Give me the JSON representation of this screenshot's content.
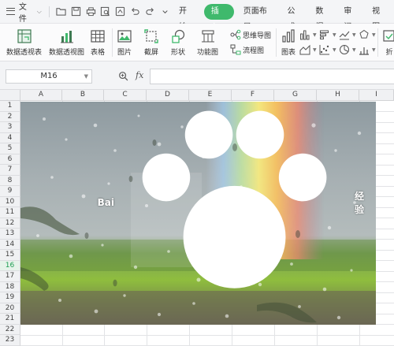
{
  "menubar": {
    "file_label": "文件",
    "tabs": [
      {
        "label": "开始"
      },
      {
        "label": "插入"
      },
      {
        "label": "页面布局"
      },
      {
        "label": "公式"
      },
      {
        "label": "数据"
      },
      {
        "label": "审阅"
      },
      {
        "label": "视图"
      }
    ],
    "active_tab": "插入",
    "accent": "#3fb96c"
  },
  "ribbon": {
    "pivot_table": "数据透视表",
    "pivot_chart": "数据透视图",
    "table": "表格",
    "picture": "图片",
    "screenshot": "截屏",
    "shapes": "形状",
    "function_chart": "功能图",
    "mind_map": "思维导图",
    "flowchart": "流程图",
    "chart": "图表",
    "fold": "折"
  },
  "formula_bar": {
    "name_box": "M16",
    "fx": "fx",
    "formula": ""
  },
  "grid": {
    "columns": [
      "A",
      "B",
      "C",
      "D",
      "E",
      "F",
      "G",
      "H",
      "I"
    ],
    "rows": [
      "1",
      "2",
      "3",
      "4",
      "5",
      "6",
      "7",
      "8",
      "9",
      "10",
      "11",
      "12",
      "13",
      "14",
      "15",
      "16",
      "17",
      "18",
      "19",
      "20",
      "21",
      "22",
      "23"
    ],
    "selected_row": "16"
  },
  "watermark": {
    "text_a": "Bai",
    "text_b": "经验"
  }
}
